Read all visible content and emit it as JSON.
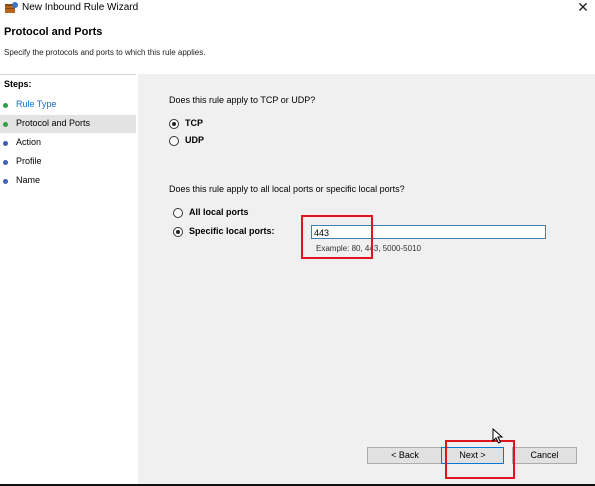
{
  "window": {
    "title": "New Inbound Rule Wizard",
    "close_glyph": "✕"
  },
  "header": {
    "title": "Protocol and Ports",
    "subtitle": "Specify the protocols and ports to which this rule applies."
  },
  "steps": {
    "title": "Steps:",
    "items": [
      {
        "label": "Rule Type",
        "state": "link"
      },
      {
        "label": "Protocol and Ports",
        "state": "current"
      },
      {
        "label": "Action",
        "state": "pending"
      },
      {
        "label": "Profile",
        "state": "pending"
      },
      {
        "label": "Name",
        "state": "pending"
      }
    ]
  },
  "protocol": {
    "question": "Does this rule apply to TCP or UDP?",
    "tcp_label": "TCP",
    "udp_label": "UDP",
    "selected": "TCP"
  },
  "ports": {
    "question": "Does this rule apply to all local ports or specific local ports?",
    "all_label": "All local ports",
    "specific_label": "Specific local ports:",
    "selected": "Specific local ports:",
    "value": "443",
    "example": "Example: 80, 443, 5000-5010"
  },
  "buttons": {
    "back": "< Back",
    "next": "Next >",
    "cancel": "Cancel"
  },
  "colors": {
    "link": "#1b6ac9",
    "green_dot": "#2ea043",
    "blue_dot": "#3d5fb6",
    "highlight": "#e0141e"
  }
}
